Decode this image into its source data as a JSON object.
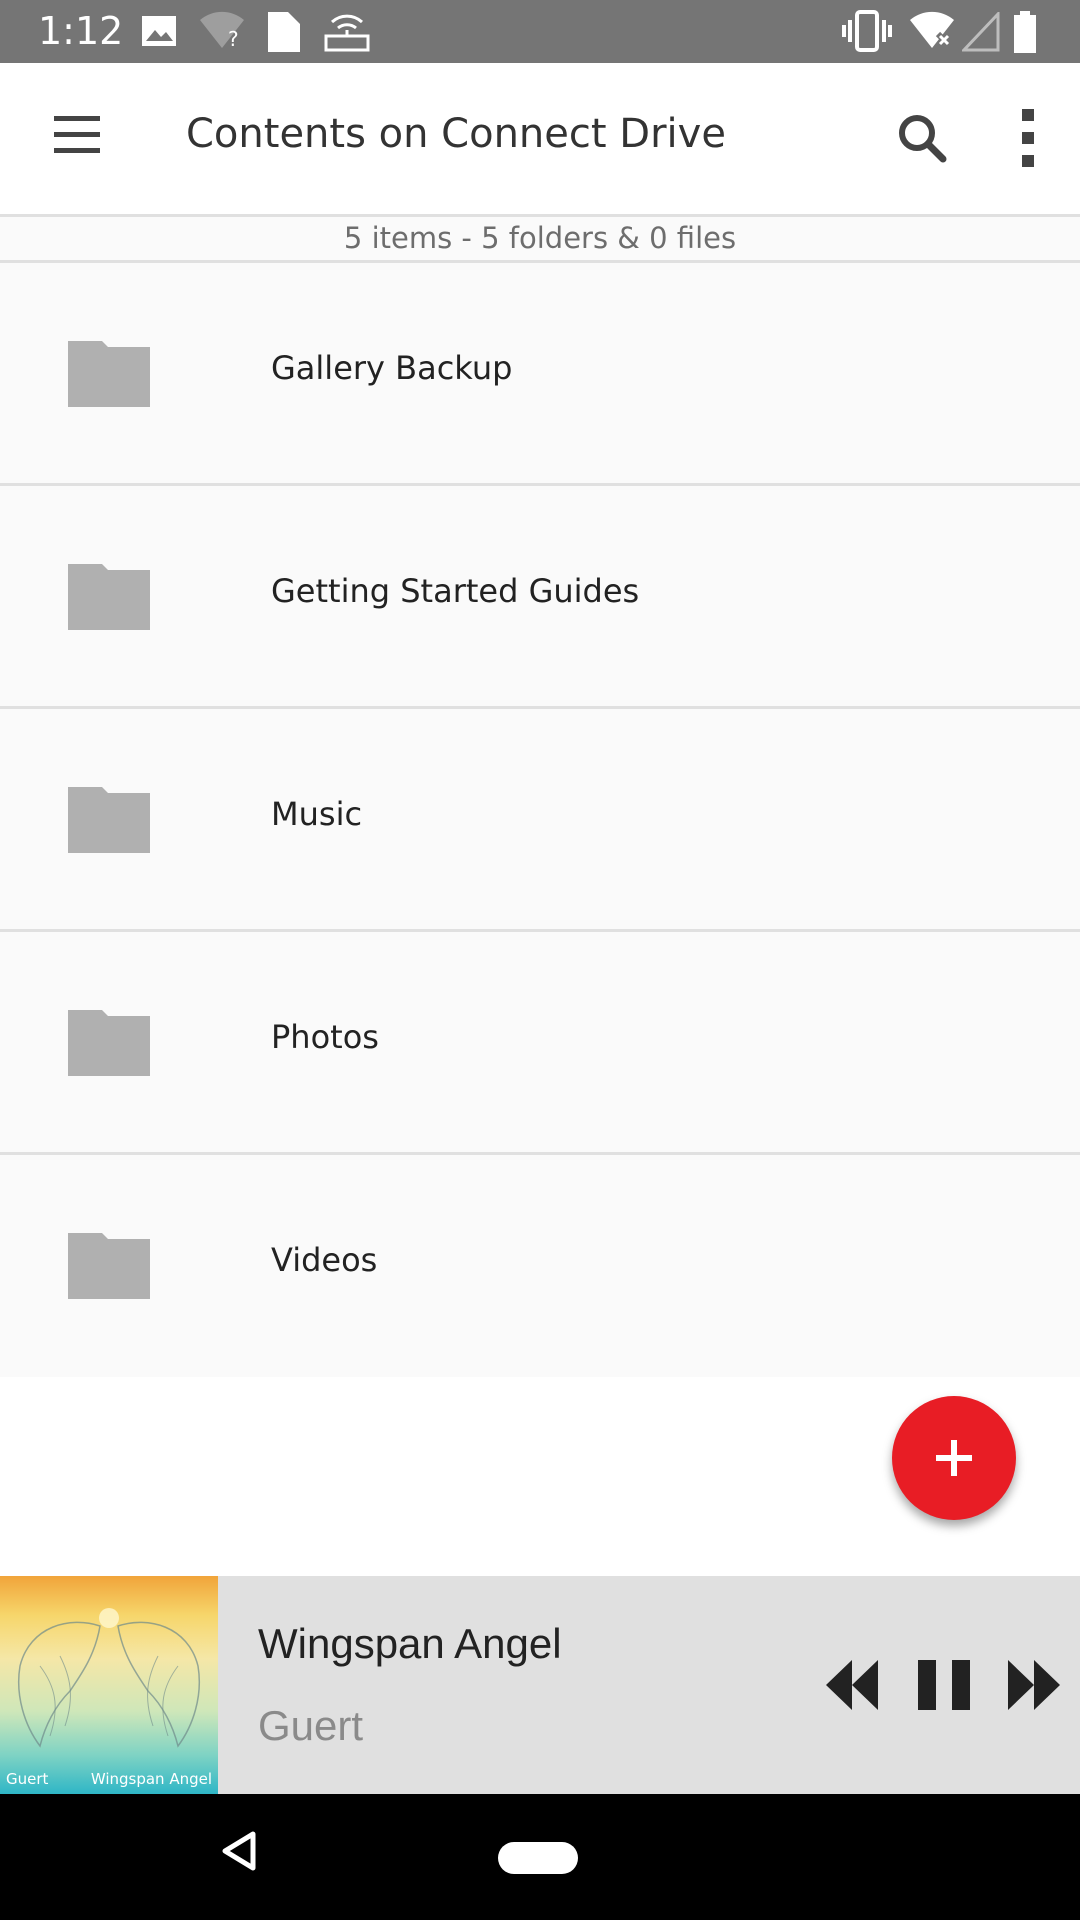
{
  "status_bar": {
    "time": "1:12",
    "icons": [
      "image-icon",
      "wifi-unknown-icon",
      "sd-card-icon",
      "router-icon",
      "vibrate-icon",
      "wifi-x-icon",
      "signal-empty-icon",
      "battery-icon"
    ]
  },
  "app_bar": {
    "title": "Contents on Connect Drive",
    "menu_icon": "hamburger-menu-icon",
    "search_icon": "search-icon",
    "more_icon": "more-vert-icon"
  },
  "summary": "5 items - 5 folders & 0 files",
  "files": [
    {
      "name": "Gallery Backup",
      "type": "folder"
    },
    {
      "name": "Getting Started Guides",
      "type": "folder"
    },
    {
      "name": "Music",
      "type": "folder"
    },
    {
      "name": "Photos",
      "type": "folder"
    },
    {
      "name": "Videos",
      "type": "folder"
    }
  ],
  "fab": {
    "icon": "plus-icon",
    "color": "#e81d25"
  },
  "player": {
    "track_title": "Wingspan Angel",
    "artist": "Guert",
    "album_art": {
      "artist_text": "Guert",
      "title_text": "Wingspan Angel"
    },
    "controls": [
      "rewind-icon",
      "pause-icon",
      "fast-forward-icon"
    ]
  },
  "nav_bar": {
    "back_icon": "back-icon",
    "home_icon": "home-pill-icon"
  },
  "colors": {
    "status_bar": "#757575",
    "list_bg": "#fafafa",
    "divider": "#e0e0e0",
    "folder_icon": "#b0b0b0",
    "accent": "#e81d25",
    "player_bg": "#e0e0e0"
  }
}
